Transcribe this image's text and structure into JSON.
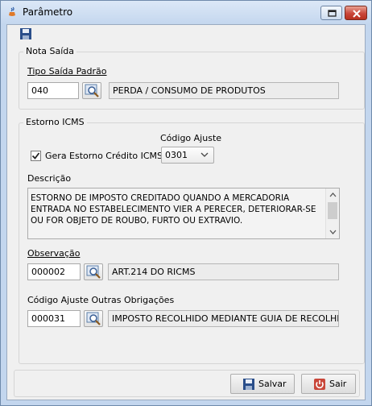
{
  "window": {
    "title": "Parâmetro"
  },
  "nota_saida": {
    "section_title": "Nota Saída",
    "tipo_label": "Tipo Saída Padrão",
    "tipo_code": "040",
    "tipo_desc": "PERDA / CONSUMO DE PRODUTOS"
  },
  "estorno": {
    "section_title": "Estorno ICMS",
    "checkbox_label": "Gera Estorno Crédito ICMS",
    "checkbox_checked": true,
    "codigo_ajuste_label": "Código Ajuste",
    "codigo_ajuste_value": "0301",
    "descricao_label": "Descrição",
    "descricao_text": "ESTORNO DE IMPOSTO CREDITADO QUANDO A MERCADORIA ENTRADA NO ESTABELECIMENTO VIER A PERECER, DETERIORAR-SE OU FOR OBJETO DE ROUBO, FURTO OU EXTRAVIO.",
    "observacao_label": "Observação",
    "observacao_code": "000002",
    "observacao_desc": "ART.214 DO RICMS",
    "outras_label": "Código Ajuste Outras Obrigações",
    "outras_code": "000031",
    "outras_desc": "IMPOSTO RECOLHIDO MEDIANTE GUIA DE RECOLHIMENT"
  },
  "buttons": {
    "save": "Salvar",
    "exit": "Sair"
  },
  "colors": {
    "accent": "#c9473a",
    "save_icon": "#2a4e8a"
  }
}
